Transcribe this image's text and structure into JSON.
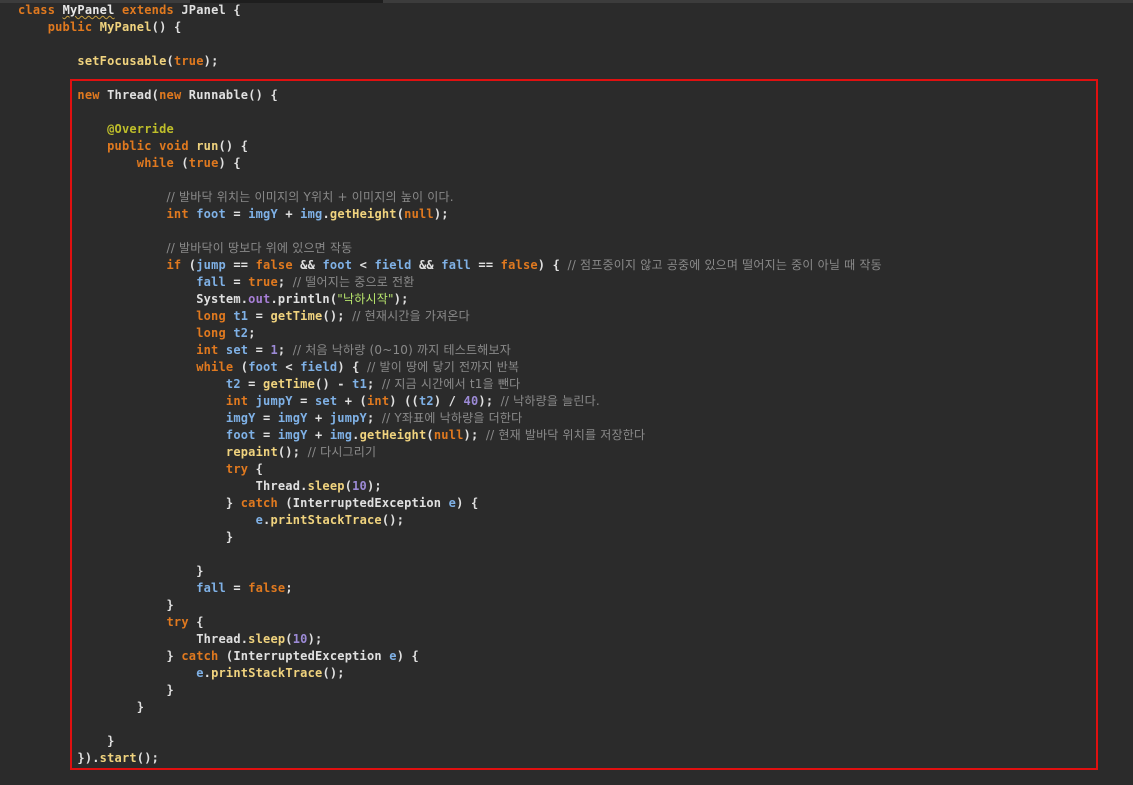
{
  "editor": {
    "language": "Java",
    "highlight_color": "#e01010",
    "lines": [
      [
        {
          "t": "kw",
          "v": "class "
        },
        {
          "t": "cls",
          "v": "MyPanel",
          "sq": true
        },
        {
          "t": "kw",
          "v": " extends "
        },
        {
          "t": "txt",
          "v": "JPanel {"
        }
      ],
      [
        {
          "t": "txt",
          "v": "    "
        },
        {
          "t": "kw",
          "v": "public "
        },
        {
          "t": "fn",
          "v": "MyPanel"
        },
        {
          "t": "txt",
          "v": "() {"
        }
      ],
      [],
      [
        {
          "t": "txt",
          "v": "        "
        },
        {
          "t": "fn",
          "v": "setFocusable"
        },
        {
          "t": "txt",
          "v": "("
        },
        {
          "t": "lit",
          "v": "true"
        },
        {
          "t": "txt",
          "v": ");"
        }
      ],
      [],
      [
        {
          "t": "txt",
          "v": "        "
        },
        {
          "t": "kw",
          "v": "new "
        },
        {
          "t": "txt",
          "v": "Thread("
        },
        {
          "t": "kw",
          "v": "new "
        },
        {
          "t": "txt",
          "v": "Runnable() {"
        }
      ],
      [],
      [
        {
          "t": "txt",
          "v": "            "
        },
        {
          "t": "ann",
          "v": "@Override"
        }
      ],
      [
        {
          "t": "txt",
          "v": "            "
        },
        {
          "t": "kw",
          "v": "public void "
        },
        {
          "t": "fn",
          "v": "run"
        },
        {
          "t": "txt",
          "v": "() {"
        }
      ],
      [
        {
          "t": "txt",
          "v": "                "
        },
        {
          "t": "kw",
          "v": "while "
        },
        {
          "t": "txt",
          "v": "("
        },
        {
          "t": "lit",
          "v": "true"
        },
        {
          "t": "txt",
          "v": ") {"
        }
      ],
      [],
      [
        {
          "t": "txt",
          "v": "                    "
        },
        {
          "t": "com",
          "v": "// 발바닥 위치는 이미지의 Y위치 + 이미지의 높이 이다."
        }
      ],
      [
        {
          "t": "txt",
          "v": "                    "
        },
        {
          "t": "kw",
          "v": "int "
        },
        {
          "t": "var",
          "v": "foot"
        },
        {
          "t": "txt",
          "v": " = "
        },
        {
          "t": "var",
          "v": "imgY"
        },
        {
          "t": "txt",
          "v": " + "
        },
        {
          "t": "var",
          "v": "img"
        },
        {
          "t": "txt",
          "v": "."
        },
        {
          "t": "fn",
          "v": "getHeight"
        },
        {
          "t": "txt",
          "v": "("
        },
        {
          "t": "lit",
          "v": "null"
        },
        {
          "t": "txt",
          "v": ");"
        }
      ],
      [],
      [
        {
          "t": "txt",
          "v": "                    "
        },
        {
          "t": "com",
          "v": "// 발바닥이 땅보다 위에 있으면 작동"
        }
      ],
      [
        {
          "t": "txt",
          "v": "                    "
        },
        {
          "t": "kw",
          "v": "if "
        },
        {
          "t": "txt",
          "v": "("
        },
        {
          "t": "var",
          "v": "jump"
        },
        {
          "t": "txt",
          "v": " == "
        },
        {
          "t": "lit",
          "v": "false"
        },
        {
          "t": "txt",
          "v": " && "
        },
        {
          "t": "var",
          "v": "foot"
        },
        {
          "t": "txt",
          "v": " < "
        },
        {
          "t": "var",
          "v": "field"
        },
        {
          "t": "txt",
          "v": " && "
        },
        {
          "t": "var",
          "v": "fall"
        },
        {
          "t": "txt",
          "v": " == "
        },
        {
          "t": "lit",
          "v": "false"
        },
        {
          "t": "txt",
          "v": ") { "
        },
        {
          "t": "com",
          "v": "// 점프중이지 않고 공중에 있으며 떨어지는 중이 아닐 때 작동"
        }
      ],
      [
        {
          "t": "txt",
          "v": "                        "
        },
        {
          "t": "var",
          "v": "fall"
        },
        {
          "t": "txt",
          "v": " = "
        },
        {
          "t": "lit",
          "v": "true"
        },
        {
          "t": "txt",
          "v": "; "
        },
        {
          "t": "com",
          "v": "// 떨어지는 중으로 전환"
        }
      ],
      [
        {
          "t": "txt",
          "v": "                        System."
        },
        {
          "t": "fld",
          "v": "out"
        },
        {
          "t": "txt",
          "v": ".println("
        },
        {
          "t": "str",
          "v": "\"낙하시작\""
        },
        {
          "t": "txt",
          "v": ");"
        }
      ],
      [
        {
          "t": "txt",
          "v": "                        "
        },
        {
          "t": "kw",
          "v": "long "
        },
        {
          "t": "var",
          "v": "t1"
        },
        {
          "t": "txt",
          "v": " = "
        },
        {
          "t": "fn",
          "v": "getTime"
        },
        {
          "t": "txt",
          "v": "(); "
        },
        {
          "t": "com",
          "v": "// 현재시간을 가져온다"
        }
      ],
      [
        {
          "t": "txt",
          "v": "                        "
        },
        {
          "t": "kw",
          "v": "long "
        },
        {
          "t": "var",
          "v": "t2"
        },
        {
          "t": "txt",
          "v": ";"
        }
      ],
      [
        {
          "t": "txt",
          "v": "                        "
        },
        {
          "t": "kw",
          "v": "int "
        },
        {
          "t": "var",
          "v": "set"
        },
        {
          "t": "txt",
          "v": " = "
        },
        {
          "t": "num",
          "v": "1"
        },
        {
          "t": "txt",
          "v": "; "
        },
        {
          "t": "com",
          "v": "// 처음 낙하량 (0~10) 까지 테스트해보자"
        }
      ],
      [
        {
          "t": "txt",
          "v": "                        "
        },
        {
          "t": "kw",
          "v": "while "
        },
        {
          "t": "txt",
          "v": "("
        },
        {
          "t": "var",
          "v": "foot"
        },
        {
          "t": "txt",
          "v": " < "
        },
        {
          "t": "var",
          "v": "field"
        },
        {
          "t": "txt",
          "v": ") { "
        },
        {
          "t": "com",
          "v": "// 발이 땅에 닿기 전까지 반복"
        }
      ],
      [
        {
          "t": "txt",
          "v": "                            "
        },
        {
          "t": "var",
          "v": "t2"
        },
        {
          "t": "txt",
          "v": " = "
        },
        {
          "t": "fn",
          "v": "getTime"
        },
        {
          "t": "txt",
          "v": "() - "
        },
        {
          "t": "var",
          "v": "t1"
        },
        {
          "t": "txt",
          "v": "; "
        },
        {
          "t": "com",
          "v": "// 지금 시간에서 t1을 뺀다"
        }
      ],
      [
        {
          "t": "txt",
          "v": "                            "
        },
        {
          "t": "kw",
          "v": "int "
        },
        {
          "t": "var",
          "v": "jumpY"
        },
        {
          "t": "txt",
          "v": " = "
        },
        {
          "t": "var",
          "v": "set"
        },
        {
          "t": "txt",
          "v": " + ("
        },
        {
          "t": "kw",
          "v": "int"
        },
        {
          "t": "txt",
          "v": ") (("
        },
        {
          "t": "var",
          "v": "t2"
        },
        {
          "t": "txt",
          "v": ") / "
        },
        {
          "t": "num",
          "v": "40"
        },
        {
          "t": "txt",
          "v": "); "
        },
        {
          "t": "com",
          "v": "// 낙하량을 늘린다."
        }
      ],
      [
        {
          "t": "txt",
          "v": "                            "
        },
        {
          "t": "var",
          "v": "imgY"
        },
        {
          "t": "txt",
          "v": " = "
        },
        {
          "t": "var",
          "v": "imgY"
        },
        {
          "t": "txt",
          "v": " + "
        },
        {
          "t": "var",
          "v": "jumpY"
        },
        {
          "t": "txt",
          "v": "; "
        },
        {
          "t": "com",
          "v": "// Y좌표에 낙하량을 더한다"
        }
      ],
      [
        {
          "t": "txt",
          "v": "                            "
        },
        {
          "t": "var",
          "v": "foot"
        },
        {
          "t": "txt",
          "v": " = "
        },
        {
          "t": "var",
          "v": "imgY"
        },
        {
          "t": "txt",
          "v": " + "
        },
        {
          "t": "var",
          "v": "img"
        },
        {
          "t": "txt",
          "v": "."
        },
        {
          "t": "fn",
          "v": "getHeight"
        },
        {
          "t": "txt",
          "v": "("
        },
        {
          "t": "lit",
          "v": "null"
        },
        {
          "t": "txt",
          "v": "); "
        },
        {
          "t": "com",
          "v": "// 현재 발바닥 위치를 저장한다"
        }
      ],
      [
        {
          "t": "txt",
          "v": "                            "
        },
        {
          "t": "fn",
          "v": "repaint"
        },
        {
          "t": "txt",
          "v": "(); "
        },
        {
          "t": "com",
          "v": "// 다시그리기"
        }
      ],
      [
        {
          "t": "txt",
          "v": "                            "
        },
        {
          "t": "kw",
          "v": "try "
        },
        {
          "t": "txt",
          "v": "{"
        }
      ],
      [
        {
          "t": "txt",
          "v": "                                Thread."
        },
        {
          "t": "fn",
          "v": "sleep"
        },
        {
          "t": "txt",
          "v": "("
        },
        {
          "t": "num",
          "v": "10"
        },
        {
          "t": "txt",
          "v": ");"
        }
      ],
      [
        {
          "t": "txt",
          "v": "                            } "
        },
        {
          "t": "kw",
          "v": "catch "
        },
        {
          "t": "txt",
          "v": "(InterruptedException "
        },
        {
          "t": "var",
          "v": "e"
        },
        {
          "t": "txt",
          "v": ") {"
        }
      ],
      [
        {
          "t": "txt",
          "v": "                                "
        },
        {
          "t": "var",
          "v": "e"
        },
        {
          "t": "txt",
          "v": "."
        },
        {
          "t": "fn",
          "v": "printStackTrace"
        },
        {
          "t": "txt",
          "v": "();"
        }
      ],
      [
        {
          "t": "txt",
          "v": "                            }"
        }
      ],
      [],
      [
        {
          "t": "txt",
          "v": "                        }"
        }
      ],
      [
        {
          "t": "txt",
          "v": "                        "
        },
        {
          "t": "var",
          "v": "fall"
        },
        {
          "t": "txt",
          "v": " = "
        },
        {
          "t": "lit",
          "v": "false"
        },
        {
          "t": "txt",
          "v": ";"
        }
      ],
      [
        {
          "t": "txt",
          "v": "                    }"
        }
      ],
      [
        {
          "t": "txt",
          "v": "                    "
        },
        {
          "t": "kw",
          "v": "try "
        },
        {
          "t": "txt",
          "v": "{"
        }
      ],
      [
        {
          "t": "txt",
          "v": "                        Thread."
        },
        {
          "t": "fn",
          "v": "sleep"
        },
        {
          "t": "txt",
          "v": "("
        },
        {
          "t": "num",
          "v": "10"
        },
        {
          "t": "txt",
          "v": ");"
        }
      ],
      [
        {
          "t": "txt",
          "v": "                    } "
        },
        {
          "t": "kw",
          "v": "catch "
        },
        {
          "t": "txt",
          "v": "(InterruptedException "
        },
        {
          "t": "var",
          "v": "e"
        },
        {
          "t": "txt",
          "v": ") {"
        }
      ],
      [
        {
          "t": "txt",
          "v": "                        "
        },
        {
          "t": "var",
          "v": "e"
        },
        {
          "t": "txt",
          "v": "."
        },
        {
          "t": "fn",
          "v": "printStackTrace"
        },
        {
          "t": "txt",
          "v": "();"
        }
      ],
      [
        {
          "t": "txt",
          "v": "                    }"
        }
      ],
      [
        {
          "t": "txt",
          "v": "                }"
        }
      ],
      [],
      [
        {
          "t": "txt",
          "v": "            }"
        }
      ],
      [
        {
          "t": "txt",
          "v": "        })."
        },
        {
          "t": "fn",
          "v": "start"
        },
        {
          "t": "txt",
          "v": "();"
        }
      ]
    ]
  }
}
